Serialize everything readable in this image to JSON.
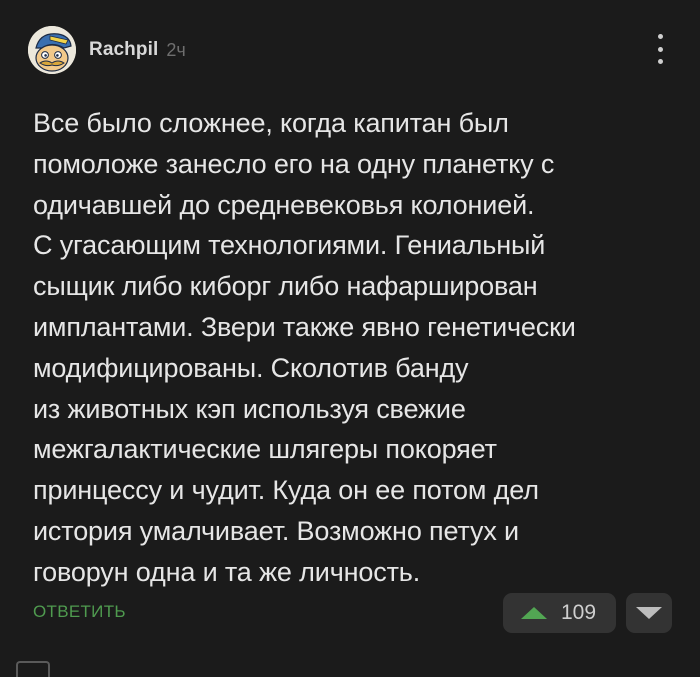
{
  "comment": {
    "author": "Rachpil",
    "time": "2ч",
    "body": "Все было сложнее, когда капитан был\nпомоложе занесло его на одну планетку с\nодичавшей до средневековья колонией.\nС угасающим технологиями. Гениальный\nсыщик либо киборг либо нафарширован\nимплантами. Звери также явно генетически\nмодифицированы. Сколотив банду\nиз животных кэп используя свежие\nмежгалактические шлягеры покоряет\nпринцессу и чудит. Куда он ее потом дел\nистория умалчивает. Возможно петух и\nговорун одна и та же личность.",
    "reply_label": "ОТВЕТИТЬ",
    "rating": "109"
  },
  "colors": {
    "background": "#1b1b1b",
    "text": "#e6e6e6",
    "accent_green": "#52a653",
    "reply_green": "#4f9b4f",
    "button_bg": "#333333",
    "muted": "#6f6f6f"
  },
  "icons": {
    "more": "more-vertical-icon",
    "upvote": "arrow-up-icon",
    "downvote": "arrow-down-icon"
  }
}
